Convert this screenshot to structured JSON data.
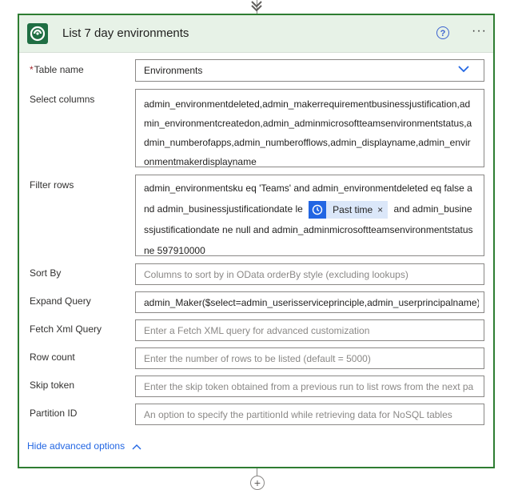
{
  "card": {
    "title": "List 7 day environments",
    "help_label": "?",
    "more_label": "···"
  },
  "fields": {
    "table_name": {
      "required_mark": "*",
      "label": "Table name",
      "value": "Environments"
    },
    "select_columns": {
      "label": "Select columns",
      "value": "admin_environmentdeleted,admin_makerrequirementbusinessjustification,admin_environmentcreatedon,admin_adminmicrosoftteamsenvironmentstatus,admin_numberofapps,admin_numberofflows,admin_displayname,admin_environmentmakerdisplayname"
    },
    "filter_rows": {
      "label": "Filter rows",
      "text_before": "admin_environmentsku eq 'Teams' and admin_environmentdeleted eq false and admin_businessjustificationdate le",
      "token_label": "Past time",
      "token_close": "×",
      "text_after": "and admin_businessjustificationdate ne null and admin_adminmicrosoftteamsenvironmentstatus ne 597910000"
    },
    "sort_by": {
      "label": "Sort By",
      "placeholder": "Columns to sort by in OData orderBy style (excluding lookups)"
    },
    "expand_query": {
      "label": "Expand Query",
      "value": "admin_Maker($select=admin_userisserviceprinciple,admin_userprincipalname)"
    },
    "fetch_xml": {
      "label": "Fetch Xml Query",
      "placeholder": "Enter a Fetch XML query for advanced customization"
    },
    "row_count": {
      "label": "Row count",
      "placeholder": "Enter the number of rows to be listed (default = 5000)"
    },
    "skip_token": {
      "label": "Skip token",
      "placeholder": "Enter the skip token obtained from a previous run to list rows from the next pa"
    },
    "partition_id": {
      "label": "Partition ID",
      "placeholder": "An option to specify the partitionId while retrieving data for NoSQL tables"
    }
  },
  "advanced": {
    "label": "Hide advanced options"
  },
  "add_step": {
    "label": "+"
  },
  "colors": {
    "accent": "#2266e3",
    "border_green": "#2e7d32",
    "header_bg": "#e7f2e7",
    "token_bg": "#dbe7f9"
  },
  "icons": {
    "logo": "dataverse-logo-icon",
    "help": "help-circle-icon",
    "more": "more-options-icon",
    "dropdown": "chevron-down-icon",
    "token": "clock-icon",
    "advanced": "chevron-up-icon",
    "top": "arrow-down-icon",
    "bottom": "plus-icon"
  }
}
